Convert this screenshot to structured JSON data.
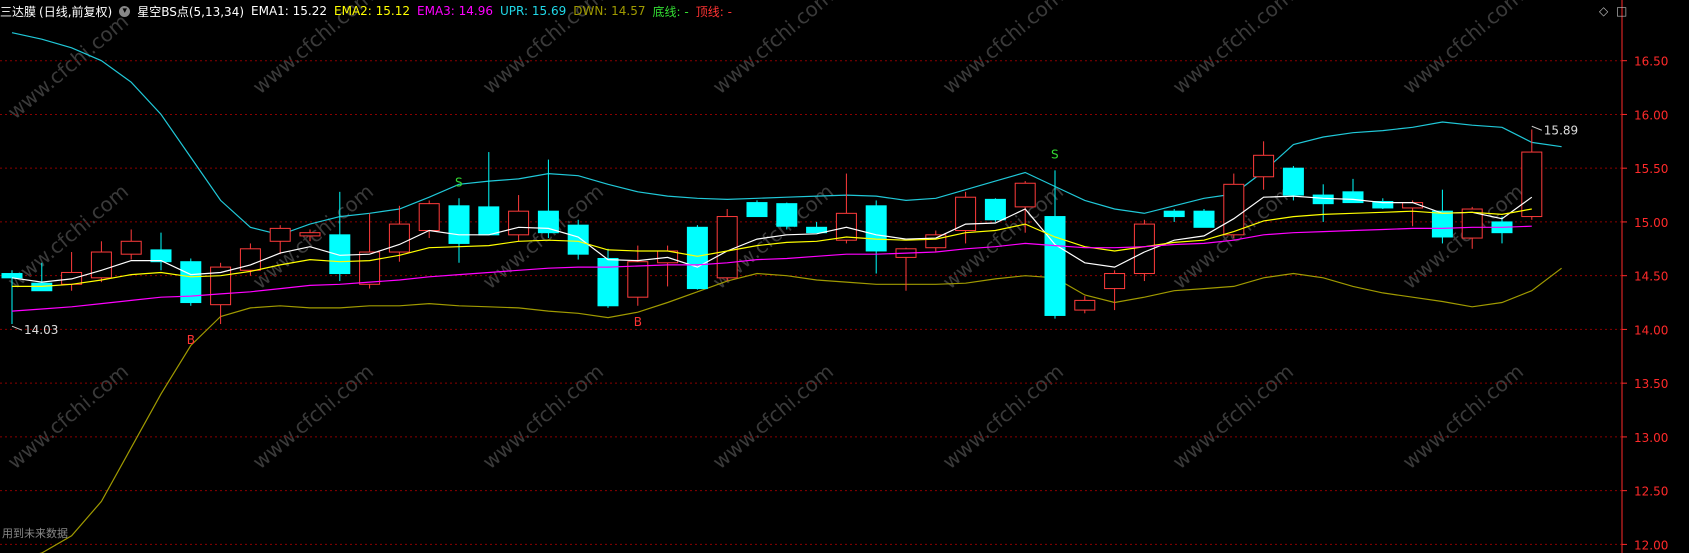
{
  "header": {
    "stock_name": "三达膜",
    "period": "(日线,前复权)",
    "indicator_name": "星空BS点(5,13,34)",
    "ema1": "EMA1: 15.22",
    "ema2": "EMA2: 15.12",
    "ema3": "EMA3: 14.96",
    "upr": "UPR: 15.69",
    "dwn": "DWN: 14.57",
    "bottom_line": "底线: -",
    "top_line": "顶线: -"
  },
  "icons": {
    "diamond": "diamond-icon",
    "square": "square-icon"
  },
  "footnote": "用到未来数据",
  "watermark": "www.cfchi.com",
  "colors": {
    "up": "#ff3b3b",
    "down": "#00ffff",
    "ema1": "#ffffff",
    "ema2": "#ffff00",
    "ema3": "#ff00ff",
    "upr": "#20c8d8",
    "dwn": "#a09a00",
    "grid": "#8b0000",
    "axis": "#ff2a2a",
    "buy": "#ff3333",
    "sell": "#33dd33"
  },
  "chart_data": {
    "type": "candlestick",
    "ylim": [
      11.92,
      16.86
    ],
    "y_ticks": [
      "16.50",
      "16.00",
      "15.50",
      "15.00",
      "14.50",
      "14.00",
      "13.50",
      "13.00",
      "12.50",
      "12.00"
    ],
    "y_tick_values": [
      16.5,
      16.0,
      15.5,
      15.0,
      14.5,
      14.0,
      13.5,
      13.0,
      12.5,
      12.0
    ],
    "candles": [
      {
        "o": 14.52,
        "h": 14.55,
        "l": 14.05,
        "c": 14.48
      },
      {
        "o": 14.43,
        "h": 14.62,
        "l": 14.4,
        "c": 14.36
      },
      {
        "o": 14.42,
        "h": 14.72,
        "l": 14.36,
        "c": 14.53
      },
      {
        "o": 14.48,
        "h": 14.82,
        "l": 14.44,
        "c": 14.72
      },
      {
        "o": 14.7,
        "h": 14.93,
        "l": 14.65,
        "c": 14.82
      },
      {
        "o": 14.74,
        "h": 14.9,
        "l": 14.55,
        "c": 14.63
      },
      {
        "o": 14.63,
        "h": 14.66,
        "l": 14.22,
        "c": 14.25
      },
      {
        "o": 14.23,
        "h": 14.62,
        "l": 14.05,
        "c": 14.58
      },
      {
        "o": 14.55,
        "h": 14.8,
        "l": 14.5,
        "c": 14.75
      },
      {
        "o": 14.82,
        "h": 14.97,
        "l": 14.7,
        "c": 14.94
      },
      {
        "o": 14.87,
        "h": 14.93,
        "l": 14.82,
        "c": 14.9
      },
      {
        "o": 14.88,
        "h": 15.28,
        "l": 14.45,
        "c": 14.52
      },
      {
        "o": 14.42,
        "h": 15.08,
        "l": 14.38,
        "c": 14.72
      },
      {
        "o": 14.72,
        "h": 15.15,
        "l": 14.63,
        "c": 14.98
      },
      {
        "o": 14.92,
        "h": 15.2,
        "l": 14.85,
        "c": 15.17
      },
      {
        "o": 15.15,
        "h": 15.22,
        "l": 14.62,
        "c": 14.8
      },
      {
        "o": 15.14,
        "h": 15.65,
        "l": 14.88,
        "c": 14.88
      },
      {
        "o": 14.88,
        "h": 15.25,
        "l": 14.82,
        "c": 15.1
      },
      {
        "o": 15.1,
        "h": 15.58,
        "l": 14.85,
        "c": 14.9
      },
      {
        "o": 14.97,
        "h": 15.02,
        "l": 14.65,
        "c": 14.7
      },
      {
        "o": 14.66,
        "h": 14.75,
        "l": 14.2,
        "c": 14.22
      },
      {
        "o": 14.3,
        "h": 14.78,
        "l": 14.22,
        "c": 14.63
      },
      {
        "o": 14.62,
        "h": 14.78,
        "l": 14.4,
        "c": 14.73
      },
      {
        "o": 14.95,
        "h": 14.97,
        "l": 14.37,
        "c": 14.38
      },
      {
        "o": 14.48,
        "h": 15.12,
        "l": 14.45,
        "c": 15.05
      },
      {
        "o": 15.18,
        "h": 15.2,
        "l": 15.05,
        "c": 15.05
      },
      {
        "o": 15.17,
        "h": 15.18,
        "l": 14.93,
        "c": 14.96
      },
      {
        "o": 14.95,
        "h": 15.0,
        "l": 14.9,
        "c": 14.9
      },
      {
        "o": 14.83,
        "h": 15.45,
        "l": 14.8,
        "c": 15.08
      },
      {
        "o": 15.15,
        "h": 15.2,
        "l": 14.52,
        "c": 14.73
      },
      {
        "o": 14.67,
        "h": 14.76,
        "l": 14.36,
        "c": 14.75
      },
      {
        "o": 14.76,
        "h": 14.92,
        "l": 14.72,
        "c": 14.88
      },
      {
        "o": 14.92,
        "h": 15.28,
        "l": 14.8,
        "c": 15.23
      },
      {
        "o": 15.21,
        "h": 15.22,
        "l": 15.0,
        "c": 15.02
      },
      {
        "o": 15.14,
        "h": 15.38,
        "l": 14.9,
        "c": 15.36
      },
      {
        "o": 15.05,
        "h": 15.48,
        "l": 14.1,
        "c": 14.13
      },
      {
        "o": 14.18,
        "h": 14.31,
        "l": 14.15,
        "c": 14.27
      },
      {
        "o": 14.38,
        "h": 14.55,
        "l": 14.18,
        "c": 14.52
      },
      {
        "o": 14.52,
        "h": 15.02,
        "l": 14.45,
        "c": 14.98
      },
      {
        "o": 15.1,
        "h": 15.12,
        "l": 15.0,
        "c": 15.05
      },
      {
        "o": 15.1,
        "h": 15.12,
        "l": 14.95,
        "c": 14.95
      },
      {
        "o": 14.88,
        "h": 15.45,
        "l": 14.85,
        "c": 15.35
      },
      {
        "o": 15.42,
        "h": 15.75,
        "l": 15.3,
        "c": 15.62
      },
      {
        "o": 15.5,
        "h": 15.52,
        "l": 15.2,
        "c": 15.25
      },
      {
        "o": 15.25,
        "h": 15.35,
        "l": 15.0,
        "c": 15.17
      },
      {
        "o": 15.28,
        "h": 15.4,
        "l": 15.18,
        "c": 15.18
      },
      {
        "o": 15.19,
        "h": 15.22,
        "l": 15.12,
        "c": 15.13
      },
      {
        "o": 15.13,
        "h": 15.2,
        "l": 14.96,
        "c": 15.18
      },
      {
        "o": 15.1,
        "h": 15.3,
        "l": 14.8,
        "c": 14.86
      },
      {
        "o": 14.85,
        "h": 15.14,
        "l": 14.75,
        "c": 15.12
      },
      {
        "o": 15.0,
        "h": 15.05,
        "l": 14.8,
        "c": 14.9
      },
      {
        "o": 15.05,
        "h": 15.86,
        "l": 15.02,
        "c": 15.65
      }
    ],
    "series": [
      {
        "name": "EMA1",
        "values": [
          14.48,
          14.44,
          14.47,
          14.55,
          14.64,
          14.64,
          14.51,
          14.53,
          14.6,
          14.71,
          14.77,
          14.69,
          14.7,
          14.79,
          14.92,
          14.88,
          14.88,
          14.95,
          14.94,
          14.86,
          14.65,
          14.64,
          14.67,
          14.58,
          14.73,
          14.84,
          14.88,
          14.89,
          14.95,
          14.88,
          14.84,
          14.85,
          14.98,
          14.99,
          15.12,
          14.79,
          14.62,
          14.58,
          14.72,
          14.83,
          14.87,
          15.03,
          15.23,
          15.24,
          15.22,
          15.21,
          15.18,
          15.18,
          15.08,
          15.09,
          15.03,
          15.23
        ]
      },
      {
        "name": "EMA2",
        "values": [
          14.4,
          14.4,
          14.42,
          14.46,
          14.51,
          14.53,
          14.49,
          14.5,
          14.54,
          14.6,
          14.65,
          14.63,
          14.64,
          14.69,
          14.76,
          14.77,
          14.78,
          14.82,
          14.83,
          14.82,
          14.74,
          14.73,
          14.73,
          14.68,
          14.73,
          14.78,
          14.81,
          14.82,
          14.86,
          14.84,
          14.83,
          14.84,
          14.9,
          14.92,
          14.98,
          14.86,
          14.77,
          14.73,
          14.77,
          14.81,
          14.83,
          14.91,
          15.01,
          15.05,
          15.07,
          15.08,
          15.09,
          15.1,
          15.08,
          15.09,
          15.07,
          15.12
        ]
      },
      {
        "name": "EMA3",
        "values": [
          14.17,
          14.19,
          14.21,
          14.24,
          14.27,
          14.3,
          14.31,
          14.33,
          14.35,
          14.38,
          14.41,
          14.42,
          14.44,
          14.46,
          14.49,
          14.51,
          14.53,
          14.55,
          14.57,
          14.58,
          14.58,
          14.59,
          14.6,
          14.6,
          14.62,
          14.65,
          14.66,
          14.68,
          14.7,
          14.7,
          14.71,
          14.72,
          14.75,
          14.77,
          14.8,
          14.78,
          14.76,
          14.76,
          14.77,
          14.79,
          14.8,
          14.83,
          14.88,
          14.9,
          14.91,
          14.92,
          14.93,
          14.94,
          14.94,
          14.95,
          14.95,
          14.96
        ]
      },
      {
        "name": "UPR",
        "values": [
          16.76,
          16.7,
          16.62,
          16.5,
          16.3,
          16.0,
          15.6,
          15.2,
          14.95,
          14.88,
          14.98,
          15.05,
          15.08,
          15.12,
          15.23,
          15.35,
          15.38,
          15.4,
          15.45,
          15.43,
          15.35,
          15.28,
          15.24,
          15.22,
          15.21,
          15.22,
          15.23,
          15.24,
          15.25,
          15.24,
          15.2,
          15.22,
          15.3,
          15.38,
          15.46,
          15.33,
          15.2,
          15.12,
          15.08,
          15.15,
          15.22,
          15.26,
          15.47,
          15.72,
          15.79,
          15.83,
          15.85,
          15.88,
          15.93,
          15.9,
          15.88,
          15.74,
          15.7
        ]
      },
      {
        "name": "DWN",
        "values": [
          11.85,
          11.92,
          12.08,
          12.4,
          12.9,
          13.4,
          13.85,
          14.12,
          14.2,
          14.22,
          14.2,
          14.2,
          14.22,
          14.22,
          14.24,
          14.22,
          14.21,
          14.2,
          14.17,
          14.15,
          14.11,
          14.16,
          14.25,
          14.35,
          14.45,
          14.52,
          14.5,
          14.46,
          14.44,
          14.42,
          14.42,
          14.42,
          14.43,
          14.47,
          14.5,
          14.48,
          14.32,
          14.25,
          14.3,
          14.36,
          14.38,
          14.4,
          14.48,
          14.52,
          14.48,
          14.4,
          14.34,
          14.3,
          14.26,
          14.21,
          14.25,
          14.36,
          14.57
        ]
      }
    ],
    "signals": [
      {
        "index": 6,
        "type": "B",
        "price": 14.05
      },
      {
        "index": 15,
        "type": "S",
        "price": 15.22
      },
      {
        "index": 21,
        "type": "B",
        "price": 14.22
      },
      {
        "index": 35,
        "type": "S",
        "price": 15.48
      }
    ],
    "annotations": [
      {
        "index": 0,
        "price": 14.03,
        "label": "14.03"
      },
      {
        "index": 51,
        "price": 15.89,
        "label": "15.89"
      }
    ]
  }
}
